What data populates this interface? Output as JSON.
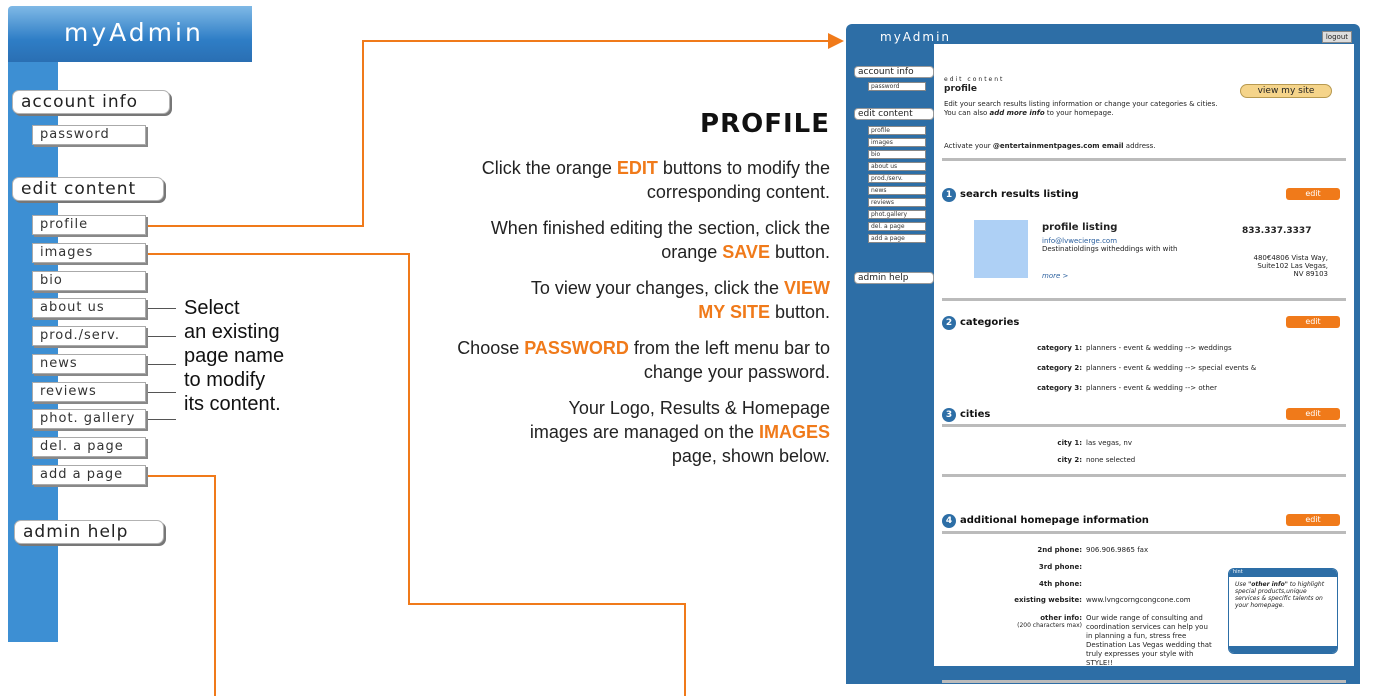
{
  "left_menu": {
    "title": "myAdmin",
    "account_info": "account info",
    "password": "password",
    "edit_content": "edit content",
    "items": [
      "profile",
      "images",
      "bio",
      "about us",
      "prod./serv.",
      "news",
      "reviews",
      "phot. gallery",
      "del. a page",
      "add a page"
    ],
    "admin_help": "admin help",
    "select_note": [
      "Select",
      "an existing",
      "page name",
      "to modify",
      "its content."
    ]
  },
  "instructions": {
    "title": "PROFILE",
    "p1_a": "Click the orange ",
    "p1_kw": "EDIT",
    "p1_b": " buttons to modify the corresponding content.",
    "p2_a": "When finished editing the section, click the orange ",
    "p2_kw": "SAVE",
    "p2_b": " button.",
    "p3_a": "To view your changes, click the ",
    "p3_kw": "VIEW MY SITE",
    "p3_b": " button.",
    "p4_a": "Choose ",
    "p4_kw": "PASSWORD",
    "p4_b": " from the left menu bar to change your password.",
    "p5_a": "Your Logo, Results & Homepage images are managed on the ",
    "p5_kw": "IMAGES",
    "p5_b": " page, shown below."
  },
  "preview": {
    "title": "myAdmin",
    "logout": "logout",
    "side": {
      "account_info": "account info",
      "password": "password",
      "edit_content": "edit content",
      "items": [
        "profile",
        "images",
        "bio",
        "about us",
        "prod./serv.",
        "news",
        "reviews",
        "phot.gallery",
        "del. a page",
        "add a page"
      ],
      "admin_help": "admin help"
    },
    "edit_content_label": "edit content",
    "page_title": "profile",
    "view_site": "view my site",
    "intro": "Edit your search results listing information or change your categories & cities. You can also ",
    "intro_em": "add more info",
    "intro_end": " to your homepage.",
    "activate_a": "Activate your ",
    "activate_b": "@entertainmentpages.com email",
    "activate_c": " address.",
    "edit": "edit",
    "s1": {
      "num": "1",
      "title": "search results listing",
      "listing": "profile listing",
      "phone": "833.337.3337",
      "email": "info@lvwecierge.com",
      "desc": "Destinatioldings witheddings with with",
      "address": "480€4806 Vista Way, Suite102 Las Vegas, NV 89103",
      "more": "more >"
    },
    "s2": {
      "num": "2",
      "title": "categories",
      "rows": [
        {
          "label": "category 1:",
          "value": "planners - event & wedding --> weddings"
        },
        {
          "label": "category 2:",
          "value": "planners - event & wedding --> special events &"
        },
        {
          "label": "category 3:",
          "value": "planners - event & wedding --> other"
        }
      ]
    },
    "s3": {
      "num": "3",
      "title": "cities",
      "rows": [
        {
          "label": "city 1:",
          "value": "las vegas, nv"
        },
        {
          "label": "city 2:",
          "value": "none selected"
        }
      ]
    },
    "s4": {
      "num": "4",
      "title": "additional homepage information",
      "rows": [
        {
          "label": "2nd phone:",
          "value": "906.906.9865 fax"
        },
        {
          "label": "3rd phone:",
          "value": ""
        },
        {
          "label": "4th phone:",
          "value": ""
        },
        {
          "label": "existing website:",
          "value": "www.lvngcorngcongcone.com"
        }
      ],
      "other_label": "other info:",
      "other_sub": "(200 characters max)",
      "other_value": "Our wide range of consulting and coordination services can help you in planning a fun, stress free Destination Las Vegas wedding that truly expresses your style with STYLE!!",
      "hint_title": "hint",
      "hint_a": "Use ",
      "hint_kw": "\"other info\"",
      "hint_b": " to highlight special products,unique services & specific talents on your homepage."
    }
  }
}
